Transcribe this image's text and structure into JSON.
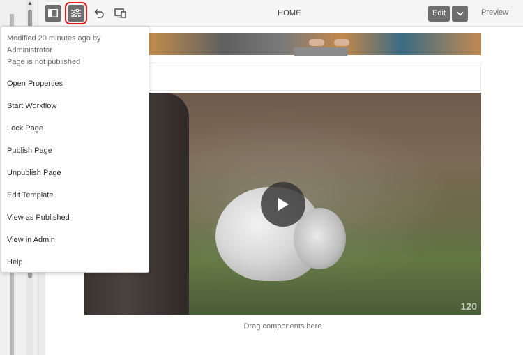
{
  "toolbar": {
    "page_title": "HOME",
    "edit_label": "Edit",
    "preview_label": "Preview",
    "icons": [
      "toggle-side-panel-icon",
      "page-information-icon",
      "undo-icon",
      "emulator-icon",
      "chevron-down-icon"
    ]
  },
  "page_info_menu": {
    "info_lines": [
      "Modified 20 minutes ago by",
      "Administrator",
      "Page is not published"
    ],
    "items": [
      {
        "label": "Open Properties"
      },
      {
        "label": "Start Workflow"
      },
      {
        "label": "Lock Page"
      },
      {
        "label": "Publish Page"
      },
      {
        "label": "Unpublish Page"
      },
      {
        "label": "Edit Template"
      },
      {
        "label": "View as Published"
      },
      {
        "label": "View in Admin"
      },
      {
        "label": "Help"
      }
    ]
  },
  "canvas": {
    "video_badge": "120",
    "drag_hint": "Drag components here"
  },
  "colors": {
    "highlight": "#e01818",
    "button_dark": "#6e6e6e"
  }
}
